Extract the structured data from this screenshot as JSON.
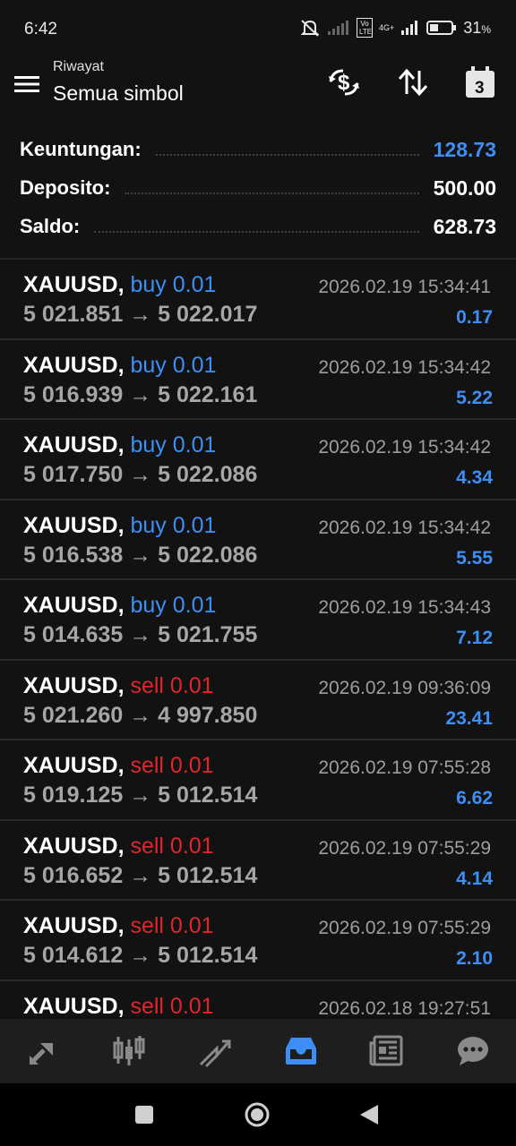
{
  "status": {
    "time": "6:42",
    "battery": "31",
    "battery_unit": "%",
    "network": "4G+",
    "volte": "Vo LTE"
  },
  "header": {
    "subtitle": "Riwayat",
    "title": "Semua simbol",
    "calendar_day": "3",
    "icons": [
      "menu-icon",
      "currency-exchange-icon",
      "sort-icon",
      "calendar-icon"
    ]
  },
  "summary": {
    "profit_label": "Keuntungan:",
    "profit_value": "128.73",
    "deposit_label": "Deposito:",
    "deposit_value": "500.00",
    "balance_label": "Saldo:",
    "balance_value": "628.73"
  },
  "trades": [
    {
      "symbol": "XAUUSD,",
      "side": "buy 0.01",
      "type": "buy",
      "open": "5 021.851",
      "close": "5 022.017",
      "time": "2026.02.19 15:34:41",
      "profit": "0.17"
    },
    {
      "symbol": "XAUUSD,",
      "side": "buy 0.01",
      "type": "buy",
      "open": "5 016.939",
      "close": "5 022.161",
      "time": "2026.02.19 15:34:42",
      "profit": "5.22"
    },
    {
      "symbol": "XAUUSD,",
      "side": "buy 0.01",
      "type": "buy",
      "open": "5 017.750",
      "close": "5 022.086",
      "time": "2026.02.19 15:34:42",
      "profit": "4.34"
    },
    {
      "symbol": "XAUUSD,",
      "side": "buy 0.01",
      "type": "buy",
      "open": "5 016.538",
      "close": "5 022.086",
      "time": "2026.02.19 15:34:42",
      "profit": "5.55"
    },
    {
      "symbol": "XAUUSD,",
      "side": "buy 0.01",
      "type": "buy",
      "open": "5 014.635",
      "close": "5 021.755",
      "time": "2026.02.19 15:34:43",
      "profit": "7.12"
    },
    {
      "symbol": "XAUUSD,",
      "side": "sell 0.01",
      "type": "sell",
      "open": "5 021.260",
      "close": "4 997.850",
      "time": "2026.02.19 09:36:09",
      "profit": "23.41"
    },
    {
      "symbol": "XAUUSD,",
      "side": "sell 0.01",
      "type": "sell",
      "open": "5 019.125",
      "close": "5 012.514",
      "time": "2026.02.19 07:55:28",
      "profit": "6.62"
    },
    {
      "symbol": "XAUUSD,",
      "side": "sell 0.01",
      "type": "sell",
      "open": "5 016.652",
      "close": "5 012.514",
      "time": "2026.02.19 07:55:29",
      "profit": "4.14"
    },
    {
      "symbol": "XAUUSD,",
      "side": "sell 0.01",
      "type": "sell",
      "open": "5 014.612",
      "close": "5 012.514",
      "time": "2026.02.19 07:55:29",
      "profit": "2.10"
    },
    {
      "symbol": "XAUUSD,",
      "side": "sell 0.01",
      "type": "sell",
      "open": "",
      "close": "",
      "time": "2026.02.18 19:27:51",
      "profit": ""
    }
  ],
  "arrow": "→",
  "bottom_nav": [
    "quotes-icon",
    "chart-icon",
    "trade-icon",
    "history-icon",
    "news-icon",
    "chat-icon"
  ],
  "active_nav": "history-icon",
  "colors": {
    "accent": "#3d8ef5",
    "sell": "#e0262b",
    "background": "#121212"
  }
}
